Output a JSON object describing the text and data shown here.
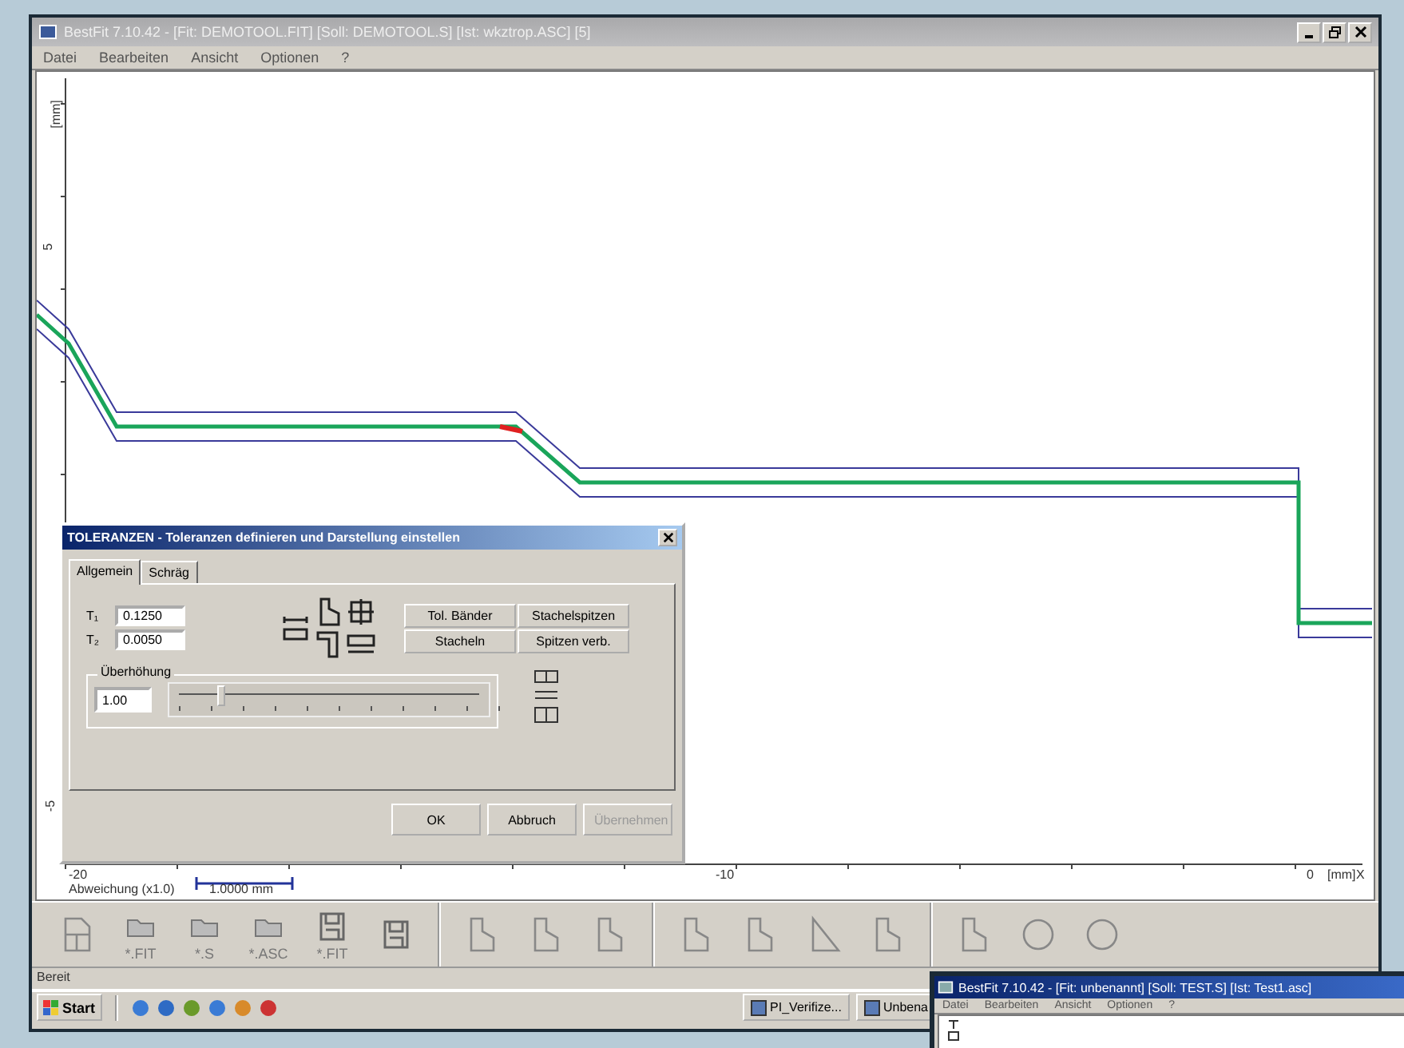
{
  "window": {
    "title": "BestFit 7.10.42 - [Fit: DEMOTOOL.FIT] [Soll: DEMOTOOL.S] [Ist: wkztrop.ASC] [5]"
  },
  "menu": [
    "Datei",
    "Bearbeiten",
    "Ansicht",
    "Optionen",
    "?"
  ],
  "plot": {
    "y_unit": "[mm]",
    "y_ticks": [
      "5",
      "-5"
    ],
    "x_ticks": [
      "-20",
      "-10",
      "0"
    ],
    "x_unit": "[mm]",
    "x_axis": "X",
    "scale_label": "Abweichung (x1.0)",
    "scale_length": "1.0000 mm"
  },
  "dialog": {
    "title": "TOLERANZEN - Toleranzen definieren und Darstellung einstellen",
    "tabs": [
      {
        "label": "Allgemein",
        "selected": true
      },
      {
        "label": "Schräg",
        "selected": false
      }
    ],
    "fields": [
      {
        "label": "T₁",
        "value": "0.1250"
      },
      {
        "label": "T₂",
        "value": "0.0050"
      }
    ],
    "toggles": [
      "Tol. Bänder",
      "Stachelspitzen",
      "Stacheln",
      "Spitzen verb."
    ],
    "exaggeration": {
      "label": "Überhöhung",
      "value": "1.00",
      "level": 0.12
    },
    "buttons": [
      {
        "label": "OK",
        "disabled": false
      },
      {
        "label": "Abbruch",
        "disabled": false
      },
      {
        "label": "Übernehmen",
        "disabled": true
      }
    ]
  },
  "toolbar": [
    {
      "kind": "new"
    },
    {
      "kind": "open",
      "label": "*.FIT"
    },
    {
      "kind": "open",
      "label": "*.S"
    },
    {
      "kind": "open",
      "label": "*.ASC"
    },
    {
      "kind": "save",
      "label": "*.FIT"
    },
    {
      "kind": "save"
    },
    {
      "kind": "sep"
    },
    {
      "kind": "shape"
    },
    {
      "kind": "shape"
    },
    {
      "kind": "shape"
    },
    {
      "kind": "sep"
    },
    {
      "kind": "shape"
    },
    {
      "kind": "shape"
    },
    {
      "kind": "triangle"
    },
    {
      "kind": "shape"
    },
    {
      "kind": "sep"
    },
    {
      "kind": "shape"
    },
    {
      "kind": "circle"
    },
    {
      "kind": "circle"
    }
  ],
  "status_bar": "Bereit",
  "taskbar": {
    "start": "Start",
    "tasks": [
      "PI_Verifize...",
      "Unbena"
    ]
  },
  "second_window": {
    "title": "BestFit 7.10.42 - [Fit: unbenannt] [Soll: TEST.S] [Ist: Test1.asc]",
    "menu": [
      "Datei",
      "Bearbeiten",
      "Ansicht",
      "Optionen",
      "?"
    ]
  }
}
